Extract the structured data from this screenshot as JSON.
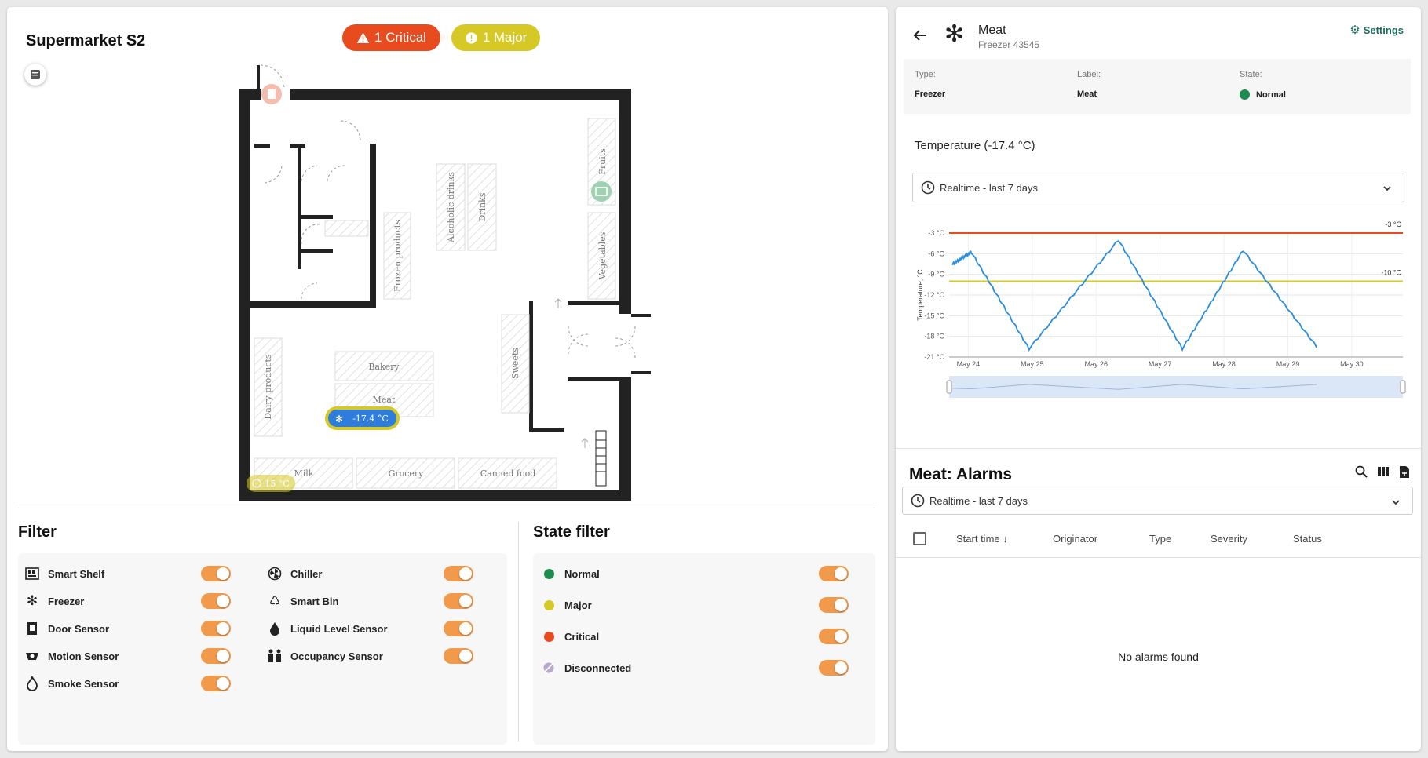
{
  "floor": {
    "title": "Supermarket S2",
    "badges": {
      "critical": "1 Critical",
      "major": "1 Major"
    },
    "rooms": [
      "Fruits",
      "Alcoholic drinks",
      "Drinks",
      "Frozen products",
      "Vegetables",
      "Sweets",
      "Bakery",
      "Meat",
      "Dairy products",
      "Milk",
      "Grocery",
      "Canned food"
    ],
    "markers": {
      "freezer": "-17.4 °C",
      "occupancy": "15 °C"
    }
  },
  "filter": {
    "title": "Filter",
    "items_left": [
      {
        "label": "Smart Shelf",
        "icon": "smart-shelf-icon",
        "on": true
      },
      {
        "label": "Freezer",
        "icon": "snowflake-icon",
        "on": true
      },
      {
        "label": "Door Sensor",
        "icon": "door-icon",
        "on": true
      },
      {
        "label": "Motion Sensor",
        "icon": "motion-sensor-icon",
        "on": true
      },
      {
        "label": "Smoke Sensor",
        "icon": "flame-icon",
        "on": true
      }
    ],
    "items_right": [
      {
        "label": "Chiller",
        "icon": "fan-icon",
        "on": true
      },
      {
        "label": "Smart Bin",
        "icon": "recycle-icon",
        "on": true
      },
      {
        "label": "Liquid Level Sensor",
        "icon": "drop-icon",
        "on": true
      },
      {
        "label": "Occupancy Sensor",
        "icon": "people-icon",
        "on": true
      }
    ]
  },
  "state_filter": {
    "title": "State filter",
    "items": [
      {
        "label": "Normal",
        "color": "#1e8c4e",
        "on": true
      },
      {
        "label": "Major",
        "color": "#d6c926",
        "on": true
      },
      {
        "label": "Critical",
        "color": "#e84b1d",
        "on": true
      },
      {
        "label": "Disconnected",
        "color": "#b9a9cc",
        "on": true
      }
    ]
  },
  "device": {
    "name": "Meat",
    "subtitle": "Freezer 43545",
    "settings_label": "Settings",
    "info": [
      {
        "key": "Type:",
        "value": "Freezer"
      },
      {
        "key": "Label:",
        "value": "Meat"
      },
      {
        "key": "State:",
        "value": "Normal"
      }
    ],
    "state_color": "#1e8c4e"
  },
  "temperature": {
    "title": "Temperature (-17.4 °C)",
    "range_label": "Realtime - last 7 days"
  },
  "chart_data": {
    "type": "line",
    "ylabel": "Temperature, °C",
    "ylim": [
      -21,
      -3
    ],
    "yticks": [
      "-3 °C",
      "-6 °C",
      "-9 °C",
      "-12 °C",
      "-15 °C",
      "-18 °C",
      "-21 °C"
    ],
    "xticks": [
      "May 24",
      "May 25",
      "May 26",
      "May 27",
      "May 28",
      "May 29",
      "May 30"
    ],
    "thresholds": [
      {
        "value": -3,
        "label": "-3 °C",
        "color": "#e84b1d"
      },
      {
        "value": -10,
        "label": "-10 °C",
        "color": "#d6c926"
      }
    ],
    "series": [
      {
        "color": "#2a8ddc",
        "x": [
          23.75,
          24.05,
          24.95,
          26.35,
          27.35,
          28.3,
          29.45
        ],
        "y": [
          -7.5,
          -5.8,
          -19.8,
          -4.0,
          -19.8,
          -5.5,
          -19.5
        ]
      }
    ]
  },
  "alarms": {
    "title": "Meat: Alarms",
    "range_label": "Realtime - last 7 days",
    "columns": [
      "Start time",
      "Originator",
      "Type",
      "Severity",
      "Status"
    ],
    "empty": "No alarms found"
  }
}
